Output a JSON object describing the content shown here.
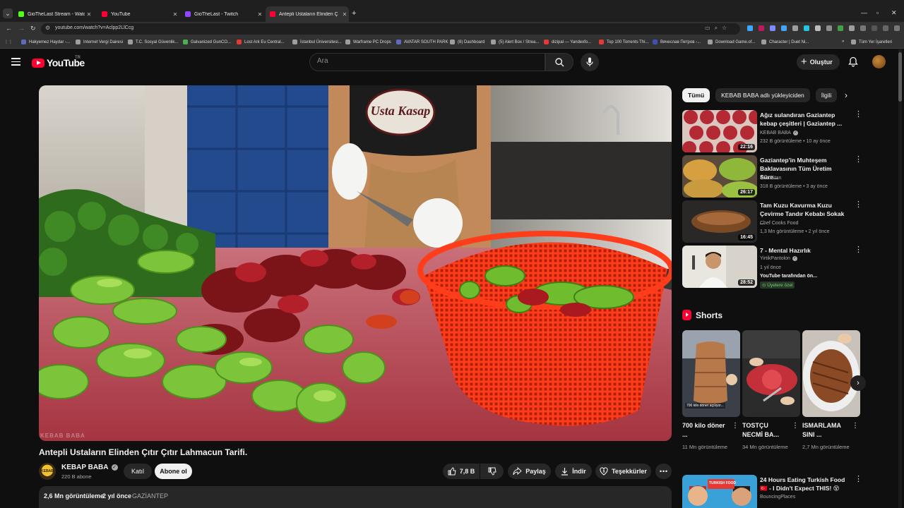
{
  "browser": {
    "tabs": [
      {
        "title": "GioTheLast Stream - Watch Live",
        "fav": "#53fc18"
      },
      {
        "title": "YouTube",
        "fav": "#ff0033"
      },
      {
        "title": "GioTheLast - Twitch",
        "fav": "#9146ff"
      },
      {
        "title": "Antepli Ustaların Elinden Ç",
        "fav": "#ff0033"
      }
    ],
    "url": "youtube.com/watch?v=Aclpp2LlCcg",
    "bookmarks": [
      "Hakyemez Haydar -...",
      "Internet Vergi Dairesi",
      "T.C. Sosyal Güvenlik...",
      "Galvanized GunCO...",
      "Lost Ark Eu Central...",
      "İstanbul Üniversitesi...",
      "Warframe PC Drops",
      "AVATAR SOUTH PARK",
      "(8) Dashboard",
      "(5) Alert Box / Strea...",
      "dizipal — Yandexfo...",
      "Top 100 Torrents Thi...",
      "Вячеслав Петров -...",
      "Download Game.of...",
      "Character | Duet Ni..."
    ],
    "all_bookmarks": "Tüm Yer İşaretleri"
  },
  "yt": {
    "logo_text": "YouTube",
    "country": "TR",
    "search_placeholder": "Ara",
    "create_label": "Oluştur"
  },
  "video": {
    "watermark": "KEBAB BABA",
    "title": "Antepli Ustaların Elinden Çıtır Çıtır Lahmacun Tarifi.",
    "channel_badge": "KEBAB",
    "channel": "KEBAP BABA",
    "subs": "220 B abone",
    "join": "Katıl",
    "subscribe": "Abone ol",
    "likes": "7,8 B",
    "share": "Paylaş",
    "download": "İndir",
    "thanks": "Teşekkürler",
    "views": "2,6 Mn görüntüleme",
    "age": "2 yıl önce",
    "location": "GAZİANTEP"
  },
  "chips": [
    "Tümü",
    "KEBAB BABA adlı yükleyiciden",
    "İlgili"
  ],
  "recommendations": [
    {
      "title": "Ağız sulandıran Gaziantep kebap çeşitleri | Gaziantep ...",
      "channel": "KEBAB BABA",
      "verified": true,
      "meta": "232 B görüntüleme • 10 ay önce",
      "duration": "22:16"
    },
    {
      "title": "Gaziantep'in Muhteşem Baklavasının Tüm Üretim Süre...",
      "channel": "FoodStan",
      "verified": false,
      "meta": "318 B görüntüleme • 3 ay önce",
      "duration": "26:17"
    },
    {
      "title": "Tam Kuzu Kavurma Kuzu Çevirme Tandır Kebabı Sokak ...",
      "channel": "Chef Cooks Food",
      "verified": false,
      "meta": "1,3 Mn görüntüleme • 2 yıl önce",
      "duration": "16:45"
    },
    {
      "title": "7 - Mental Hazırlık",
      "channel": "YirtikPantolon",
      "verified": true,
      "meta": "1 yıl önce",
      "meta2": "YouTube tarafından ön...",
      "badge": "Üyelere özel",
      "duration": "28:52"
    }
  ],
  "shorts": {
    "heading": "Shorts",
    "items": [
      {
        "title": "700 kilo döner ...",
        "views": "11 Mn görüntüleme",
        "caption": "700 kilo döner açılıyor..."
      },
      {
        "title": "TOSTÇU NECMİ BA...",
        "views": "34 Mn görüntüleme"
      },
      {
        "title": "ISMARLAMA SINI ...",
        "views": "2,7 Mn görüntüleme"
      }
    ]
  },
  "last_rec": {
    "title": "24 Hours Eating Turkish Food 🇹🇷 - I Didn't Expect THIS! 😵",
    "channel": "BouncingPlaces",
    "thumb_text": "TURKISH FOOD"
  }
}
